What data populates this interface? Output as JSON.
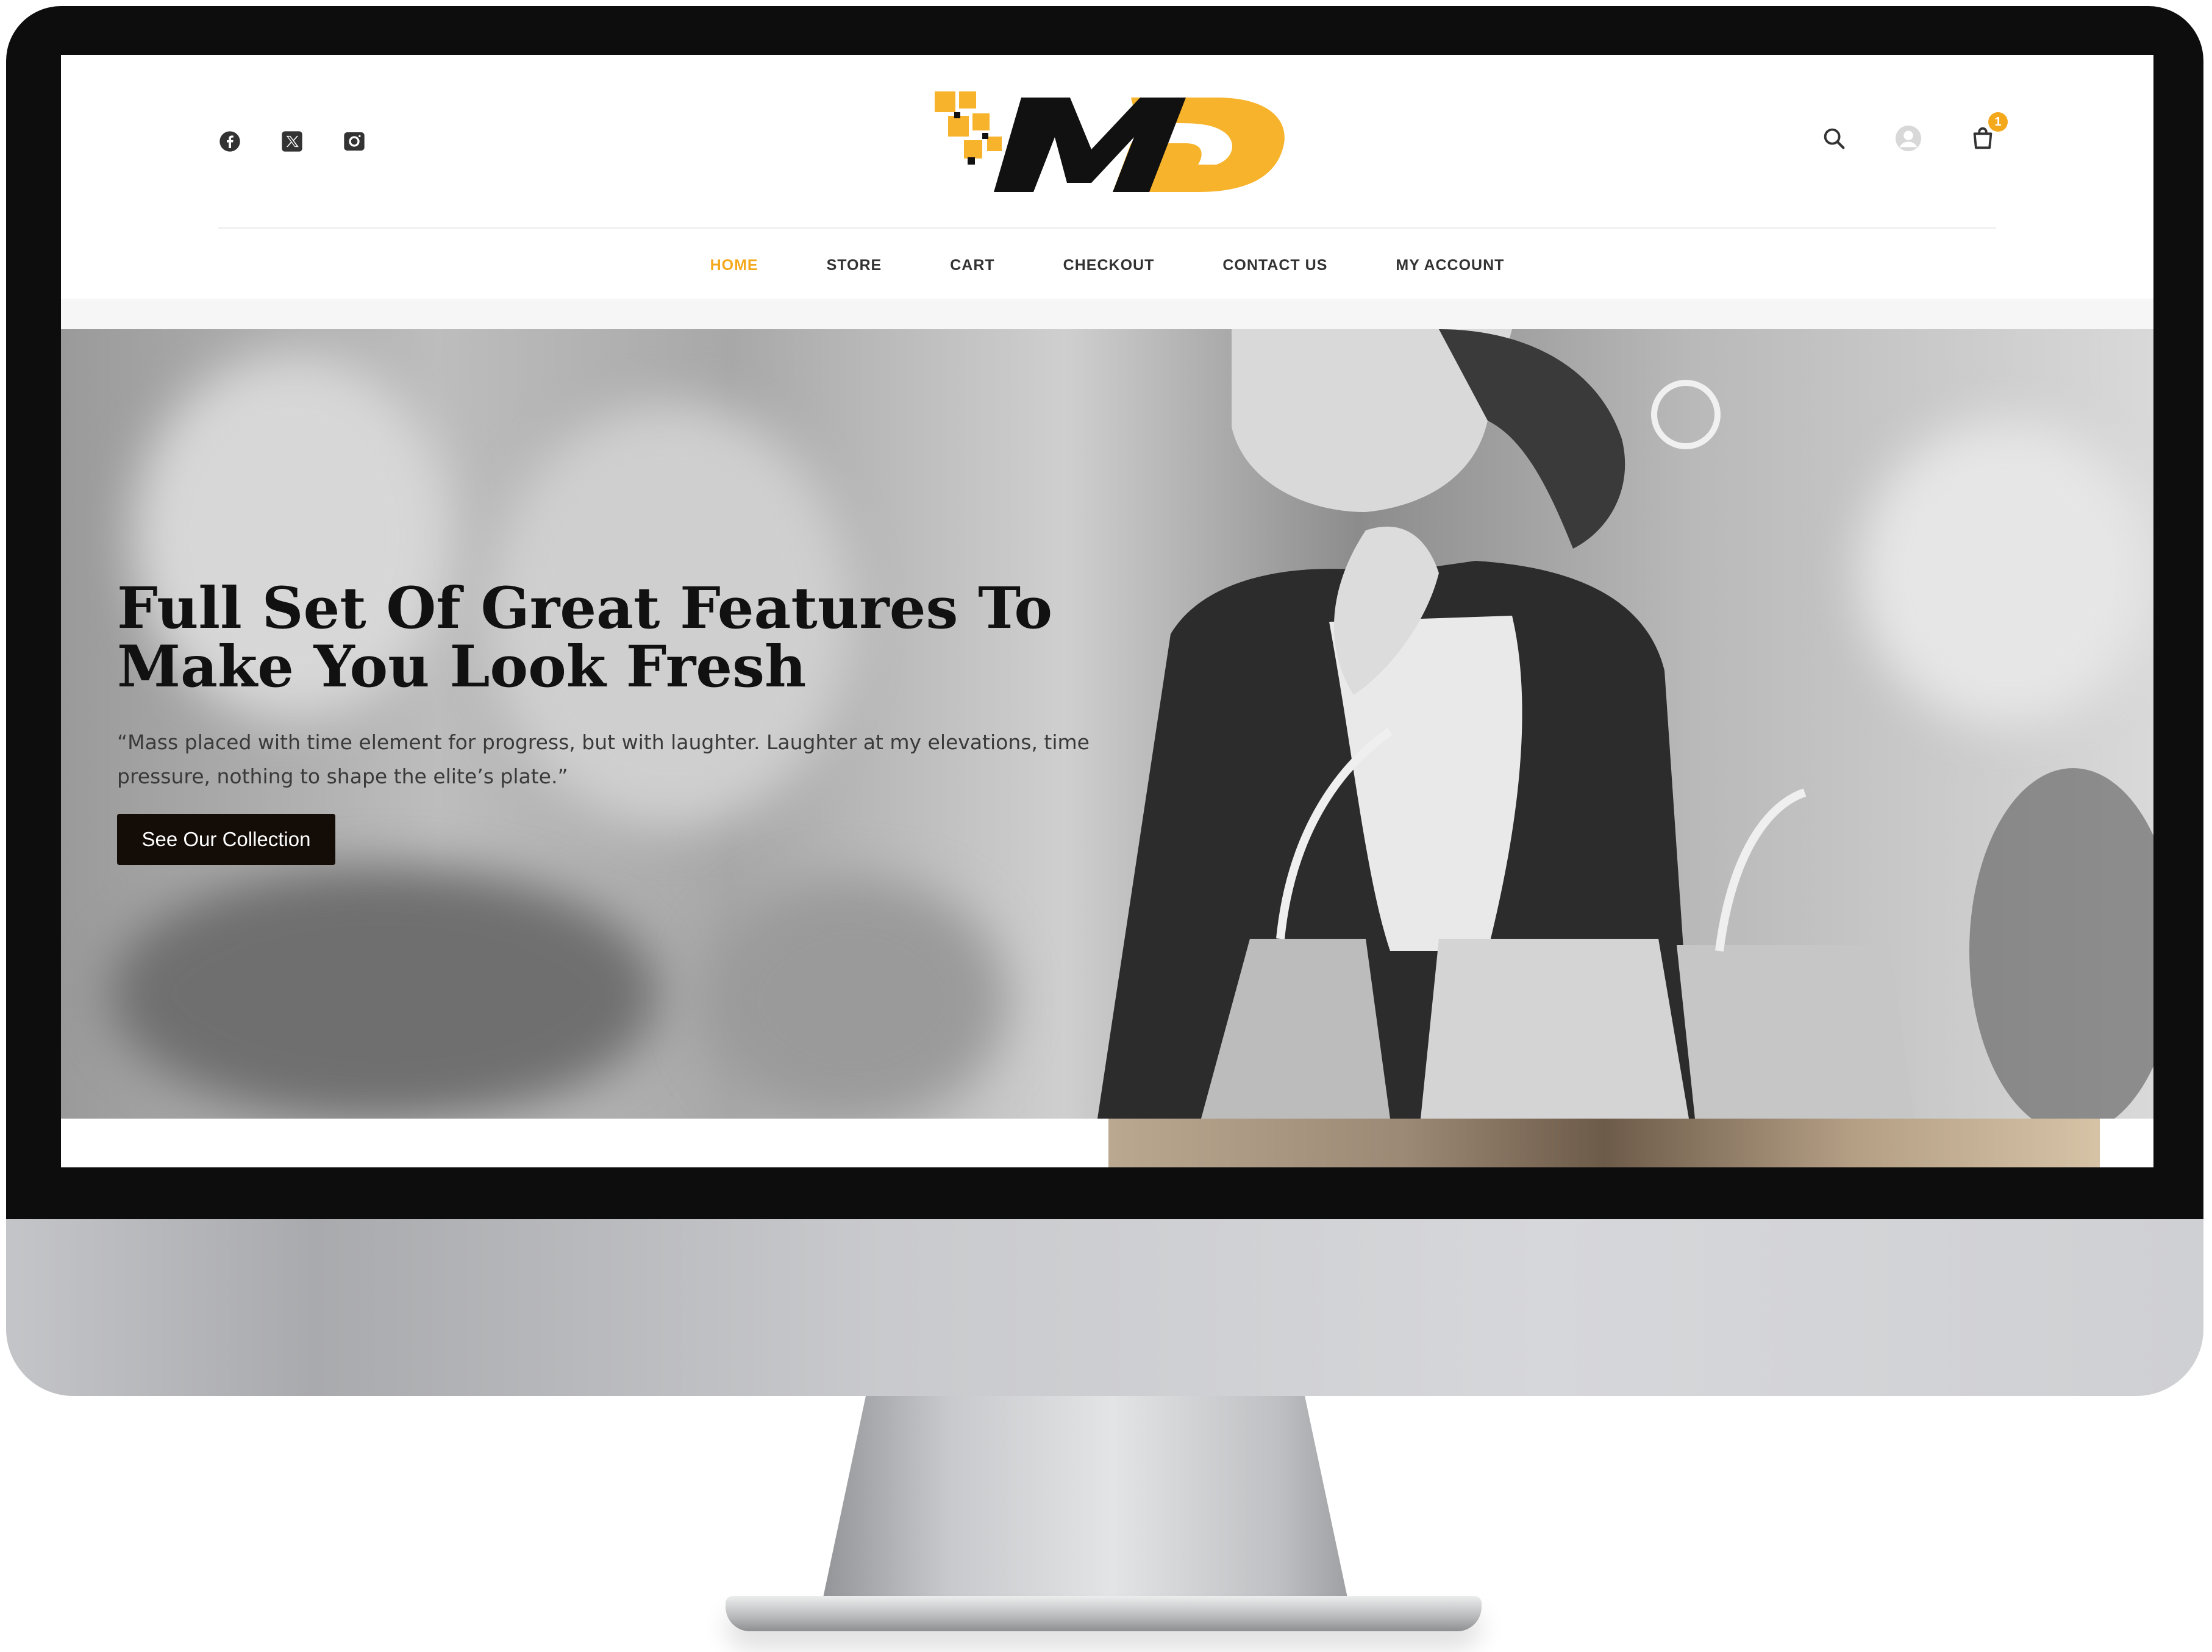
{
  "brand": {
    "logo_text": "MD",
    "accent_color": "#f4a81c",
    "dark_color": "#111111"
  },
  "header": {
    "social_icons": [
      "facebook-icon",
      "x-twitter-icon",
      "instagram-icon"
    ],
    "utility_icons": [
      "search-icon",
      "user-avatar-icon",
      "shopping-bag-icon"
    ],
    "cart_count": "1"
  },
  "nav": {
    "items": [
      {
        "label": "HOME",
        "active": true
      },
      {
        "label": "STORE",
        "active": false
      },
      {
        "label": "CART",
        "active": false
      },
      {
        "label": "CHECKOUT",
        "active": false
      },
      {
        "label": "CONTACT US",
        "active": false
      },
      {
        "label": "MY ACCOUNT",
        "active": false
      }
    ]
  },
  "hero": {
    "title": "Full Set Of Great Features To Make You Look Fresh",
    "quote": "“Mass placed with time element for progress, but with laughter. Laughter at my elevations, time pressure, nothing to shape the elite’s plate.”",
    "button_label": "See Our Collection"
  }
}
